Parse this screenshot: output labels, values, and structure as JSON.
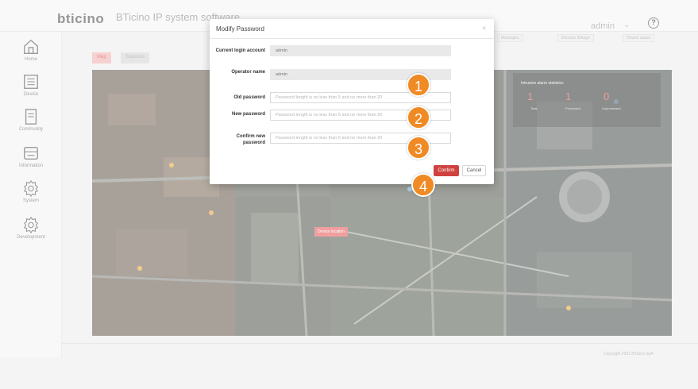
{
  "app": {
    "logo": "bticino",
    "title": "BTicino IP system software",
    "user": "admin",
    "help_icon": "?"
  },
  "sidebar": {
    "items": [
      {
        "label": "Home",
        "icon": "home-icon"
      },
      {
        "label": "Device",
        "icon": "device-icon"
      },
      {
        "label": "Community",
        "icon": "community-icon"
      },
      {
        "label": "Information",
        "icon": "information-icon"
      },
      {
        "label": "System",
        "icon": "system-gear-icon"
      },
      {
        "label": "Development",
        "icon": "development-gear-icon"
      }
    ]
  },
  "map_tabs": {
    "active": "Map",
    "inactive": "Statistics"
  },
  "header_buttons": [
    "Messages",
    "Elevator linkage",
    "Device status"
  ],
  "alarm_stats": {
    "title": "Intrusion alarm statistics",
    "values": [
      {
        "num": "1",
        "label": "Total"
      },
      {
        "num": "1",
        "label": "Processed"
      },
      {
        "num": "0",
        "label": "Unprocessed"
      }
    ]
  },
  "map_pin": "Device location",
  "footer": {
    "copyright": "Copyright 2021 BTicino SpA"
  },
  "modal": {
    "title": "Modify Password",
    "close": "×",
    "fields": [
      {
        "label": "Current login account",
        "value": "admin",
        "placeholder": ""
      },
      {
        "label": "Operator name",
        "value": "admin",
        "placeholder": ""
      },
      {
        "label": "Old password",
        "value": "",
        "placeholder": "Password length is no less than 5 and no more than 20"
      },
      {
        "label": "New password",
        "value": "",
        "placeholder": "Password length is no less than 5 and no more than 20"
      },
      {
        "label": "Confirm new password",
        "value": "",
        "placeholder": "Password length is no less than 5 and no more than 20"
      }
    ],
    "confirm": "Confirm",
    "cancel": "Cancel"
  },
  "steps": [
    "1",
    "2",
    "3",
    "4"
  ],
  "colors": {
    "accent": "#d0423f",
    "step_marker": "#f08a24",
    "stat_number": "#e25555"
  }
}
